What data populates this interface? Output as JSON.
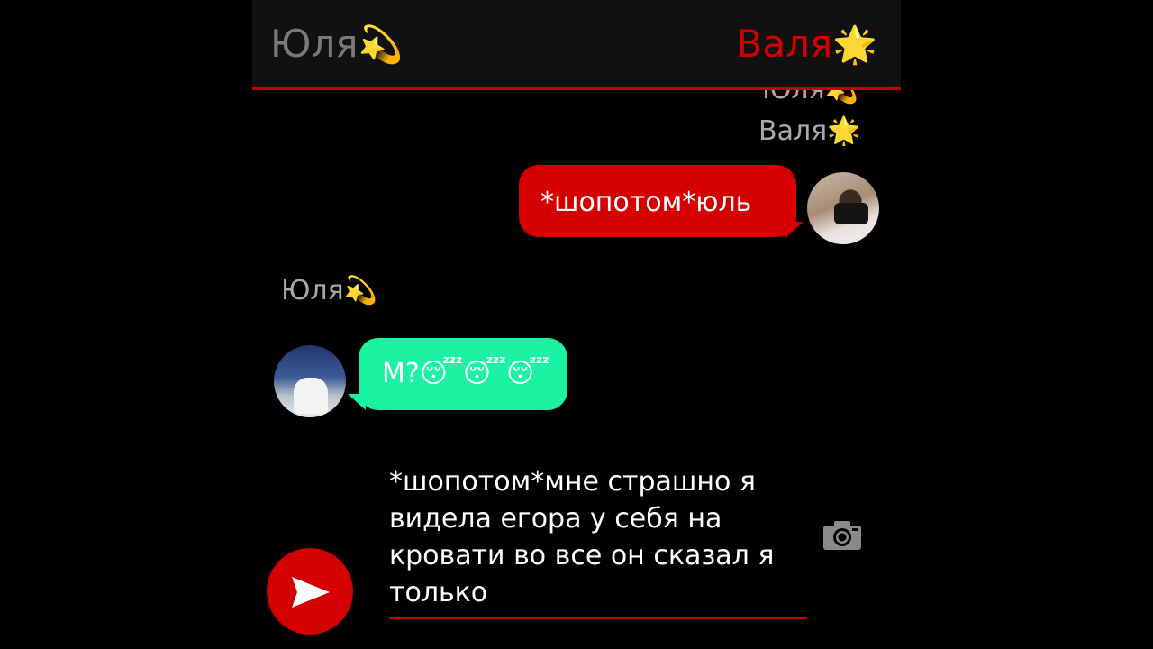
{
  "header": {
    "tab_left": {
      "name": "Юля",
      "emoji": "💫"
    },
    "tab_right": {
      "name": "Валя",
      "emoji": "🌟"
    }
  },
  "messages": [
    {
      "sender": "Юля",
      "emoji": "💫",
      "side": "right-label-partial"
    },
    {
      "sender": "Валя",
      "emoji": "🌟",
      "side": "right",
      "text": "*шопотом*юль",
      "bubble_color": "#d40000"
    },
    {
      "sender": "Юля",
      "emoji": "💫",
      "side": "left",
      "text": "М?😴😴😴",
      "bubble_color": "#1df2a3"
    }
  ],
  "compose": {
    "text": "*шопотом*мне страшно я видела егора у себя на кровати во все он сказал я только"
  },
  "icons": {
    "send": "send-arrow-icon",
    "camera": "camera-icon"
  },
  "colors": {
    "accent_red": "#d40000",
    "bubble_green": "#1df2a3",
    "header_bg": "#111111",
    "label_gray": "#a9a9a9"
  }
}
